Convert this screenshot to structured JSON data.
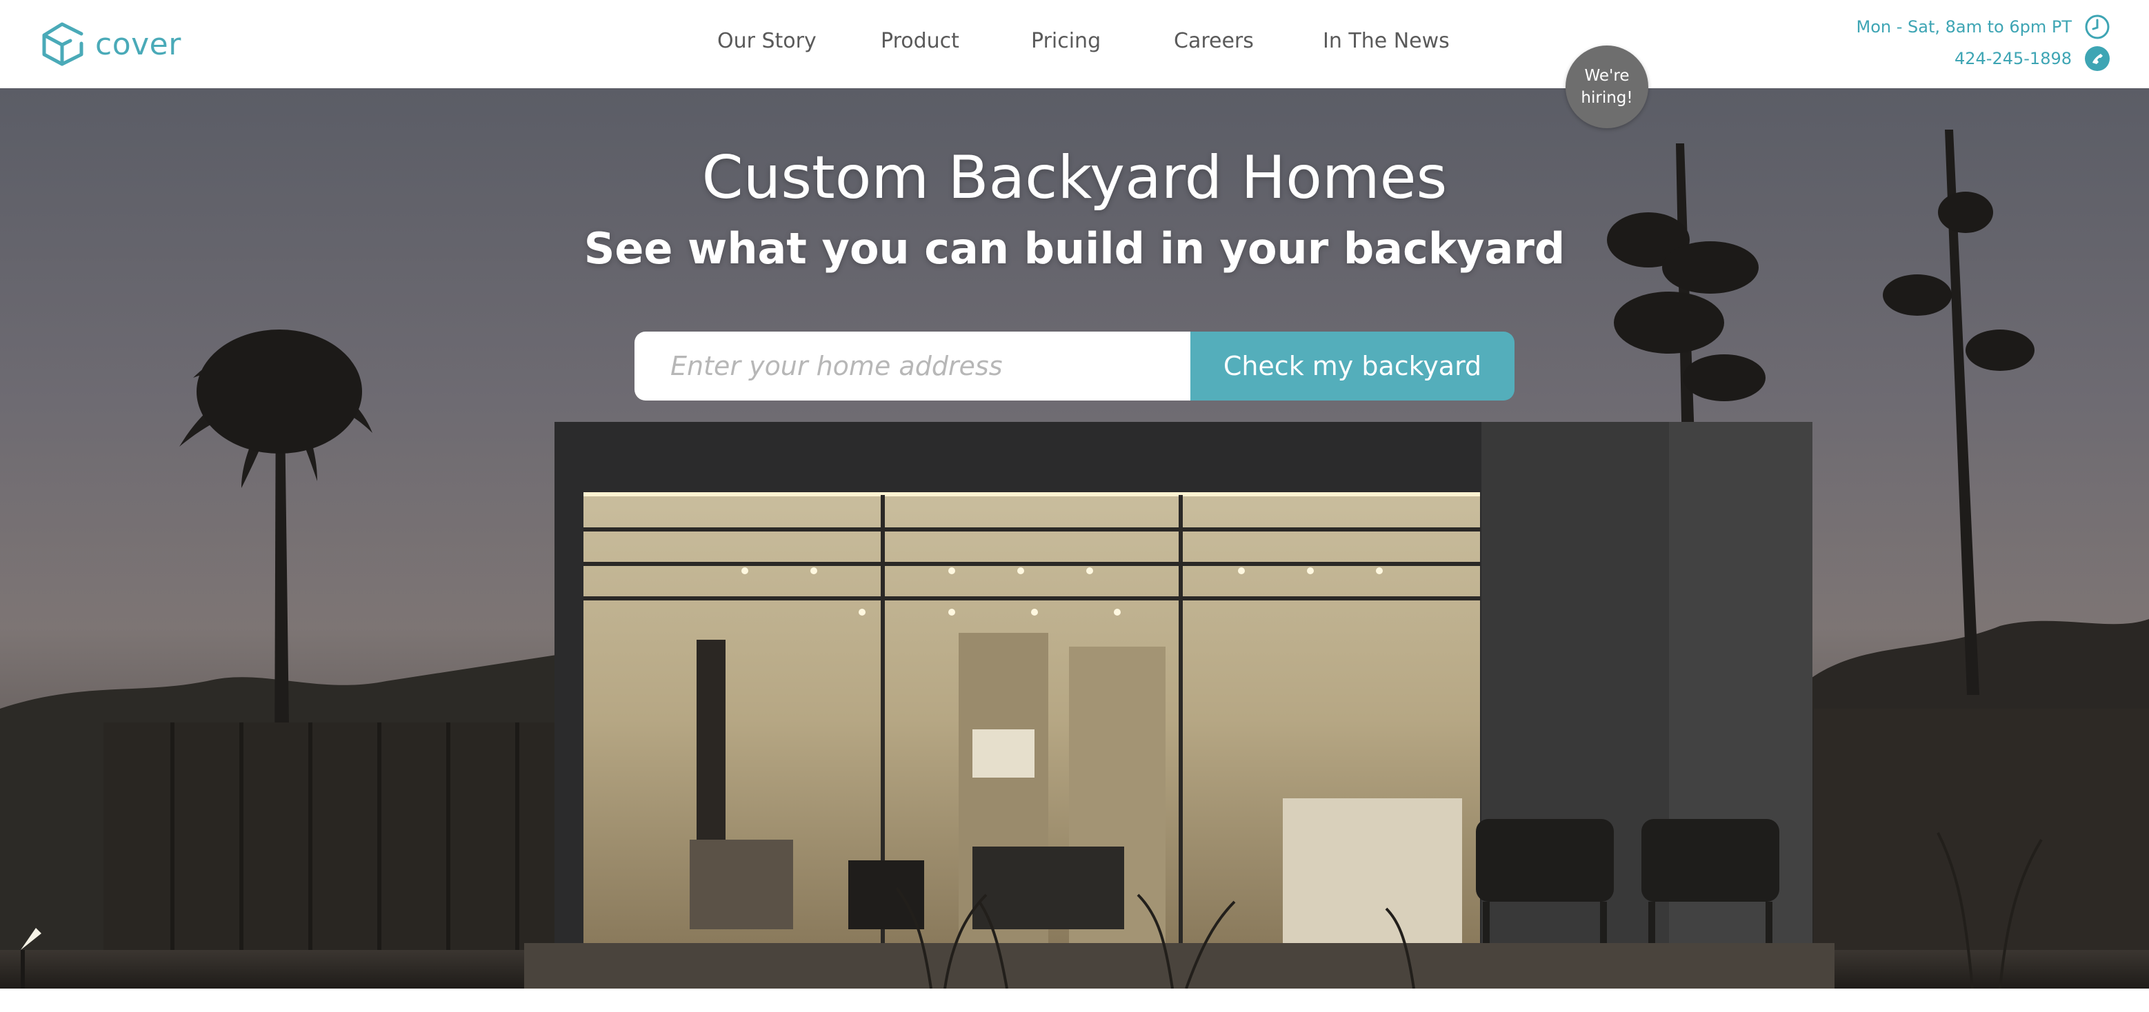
{
  "brand": {
    "name": "cover",
    "accent": "#4aaab8"
  },
  "nav": {
    "items": [
      {
        "label": "Our Story"
      },
      {
        "label": "Product"
      },
      {
        "label": "Pricing"
      },
      {
        "label": "Careers"
      },
      {
        "label": "In The News"
      }
    ]
  },
  "contact": {
    "hours": "Mon - Sat, 8am to 6pm PT",
    "phone": "424-245-1898",
    "hours_icon": "clock-icon",
    "phone_icon": "phone-icon"
  },
  "badge": {
    "text": "We're hiring!"
  },
  "hero": {
    "title": "Custom Backyard Homes",
    "subtitle": "See what you can build in your backyard",
    "address_value": "",
    "address_placeholder": "Enter your home address",
    "cta_label": "Check my backyard",
    "cta_color": "#54aebb"
  }
}
